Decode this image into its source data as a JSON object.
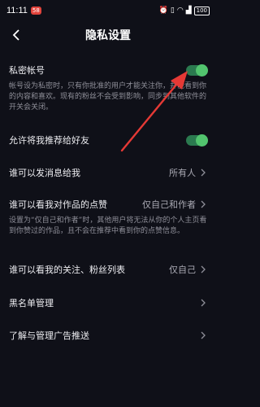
{
  "status_bar": {
    "time": "11:11",
    "badge": "58",
    "battery": "100"
  },
  "nav": {
    "title": "隐私设置"
  },
  "rows": {
    "private_account": {
      "label": "私密帐号",
      "description": "帐号设为私密时，只有你批准的用户才能关注你，并能看到你的内容和喜欢。现有的粉丝不会受到影响，同步到其他软件的开关会关闭。",
      "enabled": true
    },
    "recommend_to_friends": {
      "label": "允许将我推荐给好友",
      "enabled": true
    },
    "who_can_message": {
      "label": "谁可以发消息给我",
      "value": "所有人"
    },
    "who_can_see_likes": {
      "label": "谁可以看我对作品的点赞",
      "value": "仅自己和作者",
      "description": "设置为“仅自己和作者”时，其他用户将无法从你的个人主页看到你赞过的作品，且不会在推荐中看到你的点赞信息。"
    },
    "who_can_see_follow_list": {
      "label": "谁可以看我的关注、粉丝列表",
      "value": "仅自己"
    },
    "blacklist": {
      "label": "黑名单管理"
    },
    "ads": {
      "label": "了解与管理广告推送"
    }
  },
  "colors": {
    "background": "#0f1018",
    "toggle_on": "#52c46e",
    "annotation_arrow": "#e53935"
  }
}
